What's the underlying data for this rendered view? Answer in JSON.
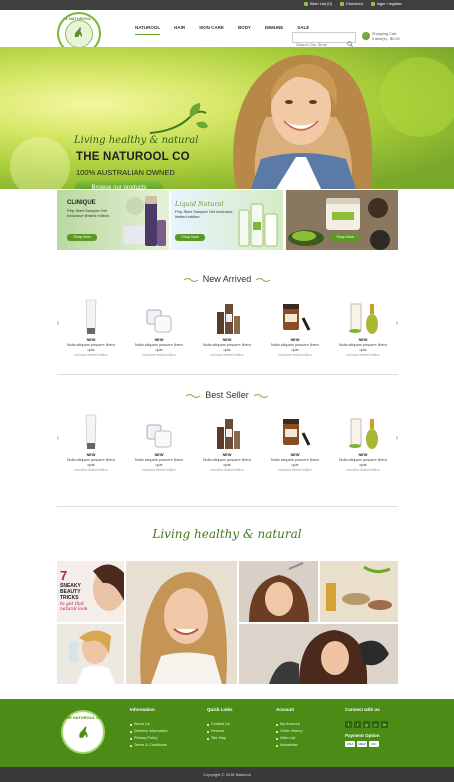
{
  "topbar": {
    "links": [
      {
        "label": "Wish List (0)",
        "icon": "heart-icon"
      },
      {
        "label": "Checkout",
        "icon": "checkout-icon"
      },
      {
        "label": "login / register",
        "icon": "user-icon"
      }
    ]
  },
  "header": {
    "logo_text": "THE NATUROOL CO",
    "logo_sub": "BEAUTY · BODY · HEALTH",
    "nav": [
      "NATUROOL",
      "HAIR",
      "SKIN CARE",
      "BODY",
      "IMMUNE",
      "SALE"
    ],
    "active_nav": "NATUROOL",
    "search_placeholder": "Search Our Store",
    "cart_label": "Shopping Cart",
    "cart_summary": "0 item(s) - $0.00"
  },
  "hero": {
    "script": "Living healthy & natural",
    "title": "THE NATUROOL CO",
    "subtitle": "100% AUSTRALIAN OWNED",
    "button": "Browse our products"
  },
  "promos": [
    {
      "title": "CLINIQUE",
      "text": "Pep-Start Sampler Set exclusive limited edition",
      "button": "Shop Now"
    },
    {
      "title": "Liquid Natural",
      "text": "Pep-Start Sampler Set exclusive limited edition",
      "button": "Shop Now"
    },
    {
      "title": "",
      "text": "",
      "button": "Shop Now"
    }
  ],
  "new_arrived": {
    "title": "New Arrived",
    "products": [
      {
        "tag": "NEW",
        "name": "Nulla aliquam posuere libero quis",
        "note": "exclusive limited edition"
      },
      {
        "tag": "NEW",
        "name": "Nulla aliquam posuere libero quis",
        "note": "exclusive limited edition"
      },
      {
        "tag": "NEW",
        "name": "Nulla aliquam posuere libero quis",
        "note": "exclusive limited edition"
      },
      {
        "tag": "NEW",
        "name": "Nulla aliquam posuere libero quis",
        "note": "exclusive limited edition"
      },
      {
        "tag": "NEW",
        "name": "Nulla aliquam posuere libero quis",
        "note": "exclusive limited edition"
      }
    ]
  },
  "best_seller": {
    "title": "Best Seller",
    "products": [
      {
        "tag": "NEW",
        "name": "Nulla aliquam posuere libero quis",
        "note": "exclusive limited edition"
      },
      {
        "tag": "NEW",
        "name": "Nulla aliquam posuere libero quis",
        "note": "exclusive limited edition"
      },
      {
        "tag": "NEW",
        "name": "Nulla aliquam posuere libero quis",
        "note": "exclusive limited edition"
      },
      {
        "tag": "NEW",
        "name": "Nulla aliquam posuere libero quis",
        "note": "exclusive limited edition"
      },
      {
        "tag": "NEW",
        "name": "Nulla aliquam posuere libero quis",
        "note": "exclusive limited edition"
      }
    ]
  },
  "gallery": {
    "title": "Living healthy & natural",
    "beauty_number": "7",
    "beauty_text": "SNEAKY BEAUTY TRICKS",
    "beauty_script": "to get that natural look"
  },
  "footer": {
    "columns": [
      {
        "heading": "Information",
        "items": [
          "About Us",
          "Delivery Information",
          "Privacy Policy",
          "Terms & Conditions"
        ]
      },
      {
        "heading": "Quick Links",
        "items": [
          "Contact Us",
          "Returns",
          "Site Map"
        ]
      },
      {
        "heading": "Account",
        "items": [
          "My Account",
          "Order History",
          "Wish List",
          "Newsletter"
        ]
      }
    ],
    "connect_heading": "Connect with us",
    "social": [
      "f",
      "t",
      "g",
      "p",
      "in"
    ],
    "payment_heading": "Payment Option",
    "payments": [
      "VISA",
      "AMEX",
      "MC"
    ],
    "copyright": "Copyright © 2016 Naturool"
  },
  "colors": {
    "brand_green": "#4a8c16",
    "accent_green": "#6aa82f",
    "topbar": "#3f3f3f"
  }
}
